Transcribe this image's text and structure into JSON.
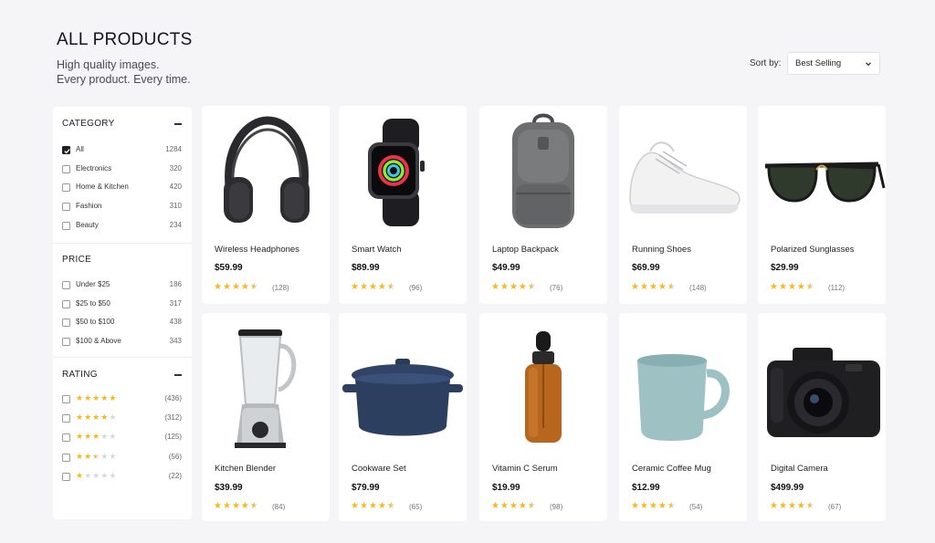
{
  "header": {
    "title": "ALL PRODUCTS",
    "subtitle_line1": "High quality images.",
    "subtitle_line2": "Every product. Every time.",
    "sort_label": "Sort by:",
    "sort_value": "Best Selling"
  },
  "filters": {
    "category": {
      "title": "CATEGORY",
      "options": [
        {
          "label": "All",
          "count": "1284",
          "checked": true
        },
        {
          "label": "Electronics",
          "count": "320",
          "checked": false
        },
        {
          "label": "Home & Kitchen",
          "count": "420",
          "checked": false
        },
        {
          "label": "Fashion",
          "count": "310",
          "checked": false
        },
        {
          "label": "Beauty",
          "count": "234",
          "checked": false
        }
      ]
    },
    "price": {
      "title": "PRICE",
      "options": [
        {
          "label": "Under $25",
          "count": "186",
          "checked": false
        },
        {
          "label": "$25 to $50",
          "count": "317",
          "checked": false
        },
        {
          "label": "$50 to $100",
          "count": "438",
          "checked": false
        },
        {
          "label": "$100 & Above",
          "count": "343",
          "checked": false
        }
      ]
    },
    "rating": {
      "title": "RATING",
      "options": [
        {
          "stars": 5,
          "count": "(436)",
          "checked": false
        },
        {
          "stars": 4,
          "count": "(312)",
          "checked": false
        },
        {
          "stars": 3,
          "count": "(125)",
          "checked": false
        },
        {
          "stars": 2.5,
          "count": "(56)",
          "checked": false
        },
        {
          "stars": 1,
          "count": "(22)",
          "checked": false
        }
      ]
    }
  },
  "products": [
    {
      "name": "Wireless Headphones",
      "price": "$59.99",
      "rating": 4.5,
      "reviews": "(128)",
      "icon": "headphones-icon"
    },
    {
      "name": "Smart Watch",
      "price": "$89.99",
      "rating": 4.5,
      "reviews": "(96)",
      "icon": "smartwatch-icon"
    },
    {
      "name": "Laptop Backpack",
      "price": "$49.99",
      "rating": 4.5,
      "reviews": "(76)",
      "icon": "backpack-icon"
    },
    {
      "name": "Running Shoes",
      "price": "$69.99",
      "rating": 4.5,
      "reviews": "(148)",
      "icon": "shoe-icon"
    },
    {
      "name": "Polarized Sunglasses",
      "price": "$29.99",
      "rating": 4.5,
      "reviews": "(112)",
      "icon": "sunglasses-icon"
    },
    {
      "name": "Kitchen Blender",
      "price": "$39.99",
      "rating": 4.5,
      "reviews": "(84)",
      "icon": "blender-icon"
    },
    {
      "name": "Cookware Set",
      "price": "$79.99",
      "rating": 4.5,
      "reviews": "(65)",
      "icon": "pot-icon"
    },
    {
      "name": "Vitamin C Serum",
      "price": "$19.99",
      "rating": 4.5,
      "reviews": "(98)",
      "icon": "serum-bottle-icon"
    },
    {
      "name": "Ceramic Coffee Mug",
      "price": "$12.99",
      "rating": 4.5,
      "reviews": "(54)",
      "icon": "mug-icon"
    },
    {
      "name": "Digital Camera",
      "price": "$499.99",
      "rating": 4.5,
      "reviews": "(67)",
      "icon": "camera-icon"
    }
  ],
  "colors": {
    "star": "#f6b91a",
    "star_empty": "#d8d8dc",
    "background": "#f5f5f7",
    "card": "#ffffff"
  }
}
